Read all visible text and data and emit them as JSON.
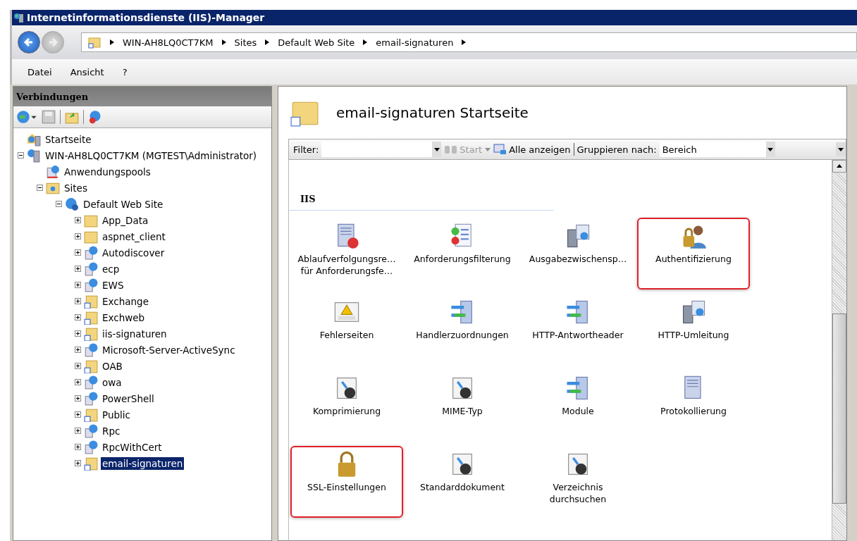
{
  "window": {
    "title": "Internetinformationsdienste (IIS)-Manager"
  },
  "breadcrumb": [
    "WIN-AH8LQ0CT7KM",
    "Sites",
    "Default Web Site",
    "email-signaturen"
  ],
  "menu": [
    "Datei",
    "Ansicht",
    "?"
  ],
  "connections": {
    "title": "Verbindungen",
    "tree": [
      {
        "label": "Startseite",
        "kind": "home",
        "selected": false
      },
      {
        "label": "WIN-AH8LQ0CT7KM (MGTEST\\Administrator)",
        "kind": "server",
        "expanded": true,
        "selected": false,
        "children": [
          {
            "label": "Anwendungspools",
            "kind": "pool",
            "selected": false
          },
          {
            "label": "Sites",
            "kind": "sites",
            "expanded": true,
            "selected": false,
            "children": [
              {
                "label": "Default Web Site",
                "kind": "website",
                "expanded": true,
                "selected": false,
                "children": [
                  {
                    "label": "App_Data",
                    "kind": "folder",
                    "expanded": false,
                    "selected": false
                  },
                  {
                    "label": "aspnet_client",
                    "kind": "folder",
                    "expanded": false,
                    "selected": false
                  },
                  {
                    "label": "Autodiscover",
                    "kind": "app",
                    "expanded": false,
                    "selected": false
                  },
                  {
                    "label": "ecp",
                    "kind": "app",
                    "expanded": false,
                    "selected": false
                  },
                  {
                    "label": "EWS",
                    "kind": "app",
                    "expanded": false,
                    "selected": false
                  },
                  {
                    "label": "Exchange",
                    "kind": "vdir",
                    "expanded": false,
                    "selected": false
                  },
                  {
                    "label": "Exchweb",
                    "kind": "vdir",
                    "expanded": false,
                    "selected": false
                  },
                  {
                    "label": "iis-signaturen",
                    "kind": "vdir",
                    "expanded": false,
                    "selected": false
                  },
                  {
                    "label": "Microsoft-Server-ActiveSync",
                    "kind": "app",
                    "expanded": false,
                    "selected": false
                  },
                  {
                    "label": "OAB",
                    "kind": "vdir",
                    "expanded": false,
                    "selected": false
                  },
                  {
                    "label": "owa",
                    "kind": "app",
                    "expanded": false,
                    "selected": false
                  },
                  {
                    "label": "PowerShell",
                    "kind": "app",
                    "expanded": false,
                    "selected": false
                  },
                  {
                    "label": "Public",
                    "kind": "vdir",
                    "expanded": false,
                    "selected": false
                  },
                  {
                    "label": "Rpc",
                    "kind": "app",
                    "expanded": false,
                    "selected": false
                  },
                  {
                    "label": "RpcWithCert",
                    "kind": "app",
                    "expanded": false,
                    "selected": false
                  },
                  {
                    "label": "email-signaturen",
                    "kind": "vdir",
                    "expanded": false,
                    "selected": true
                  }
                ]
              }
            ]
          }
        ]
      }
    ]
  },
  "page": {
    "title": "email-signaturen Startseite",
    "filter": {
      "label": "Filter:",
      "start": "Start",
      "show_all": "Alle anzeigen",
      "group_label": "Gruppieren nach:",
      "group_value": "Bereich"
    },
    "group": "IIS",
    "features": [
      {
        "label": "Ablaufverfolgungsre… für Anforderungsfe…",
        "highlighted": false
      },
      {
        "label": "Anforderungsfilterung",
        "highlighted": false
      },
      {
        "label": "Ausgabezwischensp…",
        "highlighted": false
      },
      {
        "label": "Authentifizierung",
        "highlighted": true
      },
      {
        "label": "Fehlerseiten",
        "highlighted": false
      },
      {
        "label": "Handlerzuordnungen",
        "highlighted": false
      },
      {
        "label": "HTTP-Antwortheader",
        "highlighted": false
      },
      {
        "label": "HTTP-Umleitung",
        "highlighted": false
      },
      {
        "label": "Komprimierung",
        "highlighted": false
      },
      {
        "label": "MIME-Typ",
        "highlighted": false
      },
      {
        "label": "Module",
        "highlighted": false
      },
      {
        "label": "Protokollierung",
        "highlighted": false
      },
      {
        "label": "SSL-Einstellungen",
        "highlighted": true
      },
      {
        "label": "Standarddokument",
        "highlighted": false
      },
      {
        "label": "Verzeichnis durchsuchen",
        "highlighted": false
      }
    ]
  }
}
